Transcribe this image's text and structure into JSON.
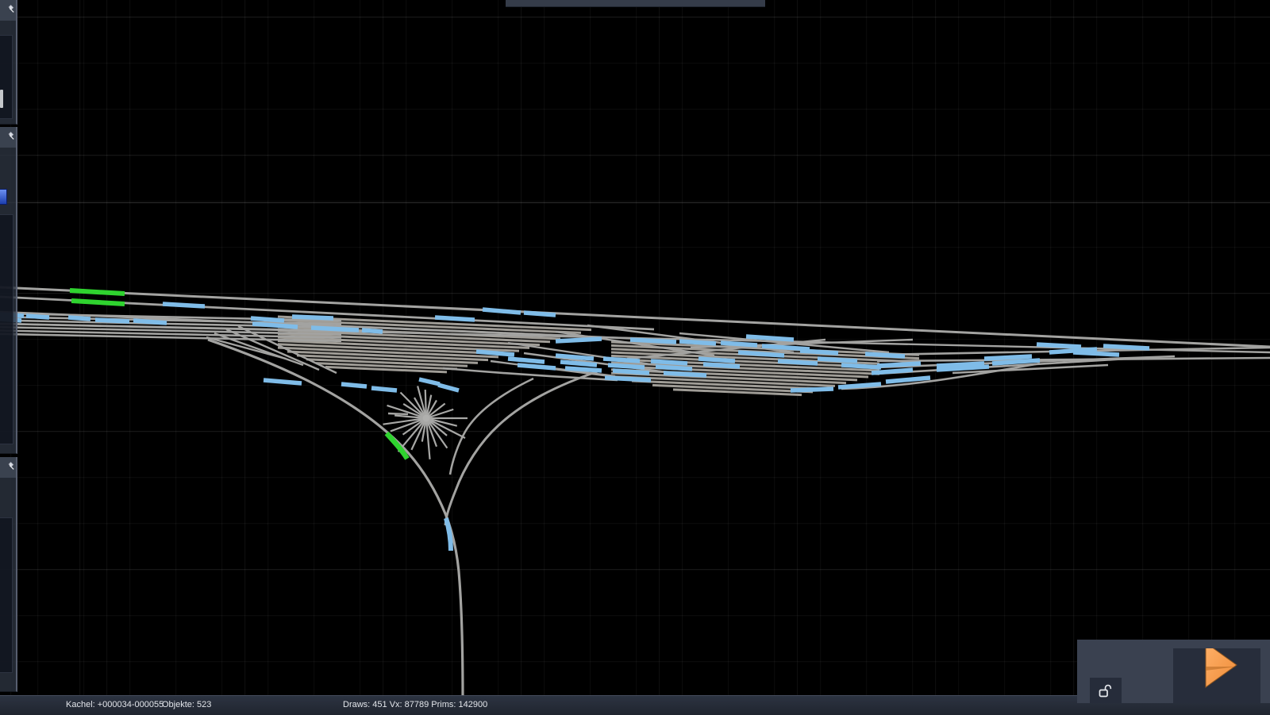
{
  "statusbar": {
    "kachel": "Kachel: +000034-000055",
    "objekte": "Objekte: 523",
    "stats": "Draws: 451 Vx: 87789 Prims: 142900"
  },
  "editor_values": {
    "tile": "+000034-000055",
    "objects": "523",
    "draws": "451",
    "vertices": "87789",
    "primitives": "142900"
  },
  "controls": {
    "play_button": "play",
    "mouse_lock": "unlocked"
  },
  "panels": {
    "left_docks": [
      "dock-panel-top",
      "dock-panel-middle",
      "dock-panel-bottom"
    ],
    "pin_icon": "pushpin"
  },
  "colors": {
    "background": "#000000",
    "track_gray": "#a3a3a1",
    "selection_blue": "#7fbce8",
    "marked_green": "#2fd32f",
    "play_orange": "#f79b4e",
    "panel_gray": "#3a4150",
    "status_bg": "#262c38"
  }
}
